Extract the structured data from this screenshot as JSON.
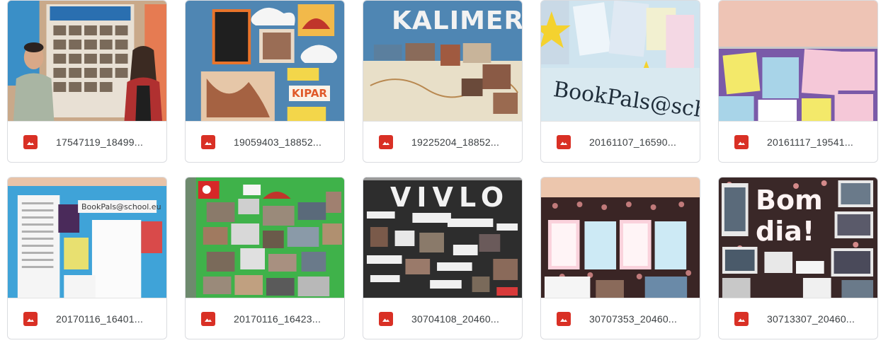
{
  "files": [
    {
      "name": "17547119_18499...",
      "icon": "image-file-icon",
      "thumb_text": ""
    },
    {
      "name": "19059403_18852...",
      "icon": "image-file-icon",
      "thumb_text": "KIPAR"
    },
    {
      "name": "19225204_18852...",
      "icon": "image-file-icon",
      "thumb_text": "KALIMERA!"
    },
    {
      "name": "20161107_16590...",
      "icon": "image-file-icon",
      "thumb_text": "BookPals@sch"
    },
    {
      "name": "20161117_19541...",
      "icon": "image-file-icon",
      "thumb_text": ""
    },
    {
      "name": "20170116_16401...",
      "icon": "image-file-icon",
      "thumb_text": "BookPals@school.eu"
    },
    {
      "name": "20170116_16423...",
      "icon": "image-file-icon",
      "thumb_text": ""
    },
    {
      "name": "30704108_20460...",
      "icon": "image-file-icon",
      "thumb_text": "VIVLO"
    },
    {
      "name": "30707353_20460...",
      "icon": "image-file-icon",
      "thumb_text": ""
    },
    {
      "name": "30713307_20460...",
      "icon": "image-file-icon",
      "thumb_text": "Bom dia!"
    }
  ],
  "colors": {
    "file_icon": "#d93025",
    "card_border": "#dadce0",
    "text": "#3c4043"
  }
}
